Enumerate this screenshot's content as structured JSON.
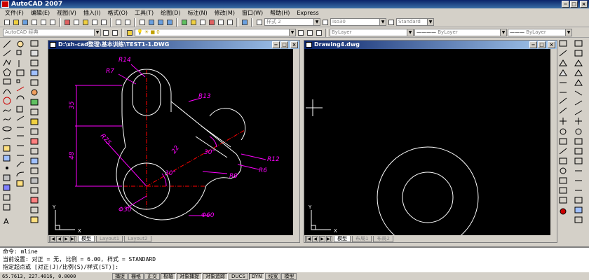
{
  "app": {
    "title": "AutoCAD 2007"
  },
  "menubar": {
    "items": [
      "文件(F)",
      "编辑(E)",
      "视图(V)",
      "插入(I)",
      "格式(O)",
      "工具(T)",
      "绘图(D)",
      "标注(N)",
      "修改(M)",
      "窗口(W)",
      "帮助(H)",
      "Express"
    ]
  },
  "toolbar": {
    "workspace": "AutoCAD 经典",
    "textstyle": "样式 2",
    "dimstyle": "iso30",
    "tablestyle": "Standard",
    "color": "ByLayer",
    "linetype": "ByLayer",
    "lineweight": "ByLayer"
  },
  "drawing1": {
    "title": "D:\\xh-cad整理\\基本训练\\TEST1-1.DWG",
    "tabs": [
      "模型",
      "Layout1",
      "Layout2"
    ],
    "dims": {
      "r14": "R14",
      "r7": "R7",
      "r13": "R13",
      "d35": "35",
      "d48": "48",
      "r75": "R75",
      "d22": "22",
      "r12": "R12",
      "r6": "R6",
      "r9": "R9",
      "a30a": "30°",
      "a30b": "30°",
      "phi30": "Φ30",
      "phi60": "Φ60"
    }
  },
  "drawing2": {
    "title": "Drawing4.dwg",
    "tabs": [
      "模型",
      "布局1",
      "布局2"
    ]
  },
  "command": {
    "line1": "命令:  mline",
    "line2": "当前设置: 对正 = 无, 比例 = 6.00, 样式 = STANDARD",
    "line3": "指定起点或 [对正(J)/比例(S)/样式(ST)]:"
  },
  "status": {
    "coords": "65.7613,  227.4016, 0.0000",
    "buttons": [
      "捕捉",
      "栅格",
      "正交",
      "极轴",
      "对象捕捉",
      "对象追踪",
      "DUCS",
      "DYN",
      "线宽",
      "模型"
    ]
  },
  "colors": {
    "canvas": "#000000",
    "dim": "#ff00ff",
    "centerline": "#ff0000",
    "geometry": "#ffffff",
    "titlebar": "#0a246a"
  },
  "icons": {
    "window_min": "−",
    "window_max": "□",
    "window_close": "×"
  }
}
